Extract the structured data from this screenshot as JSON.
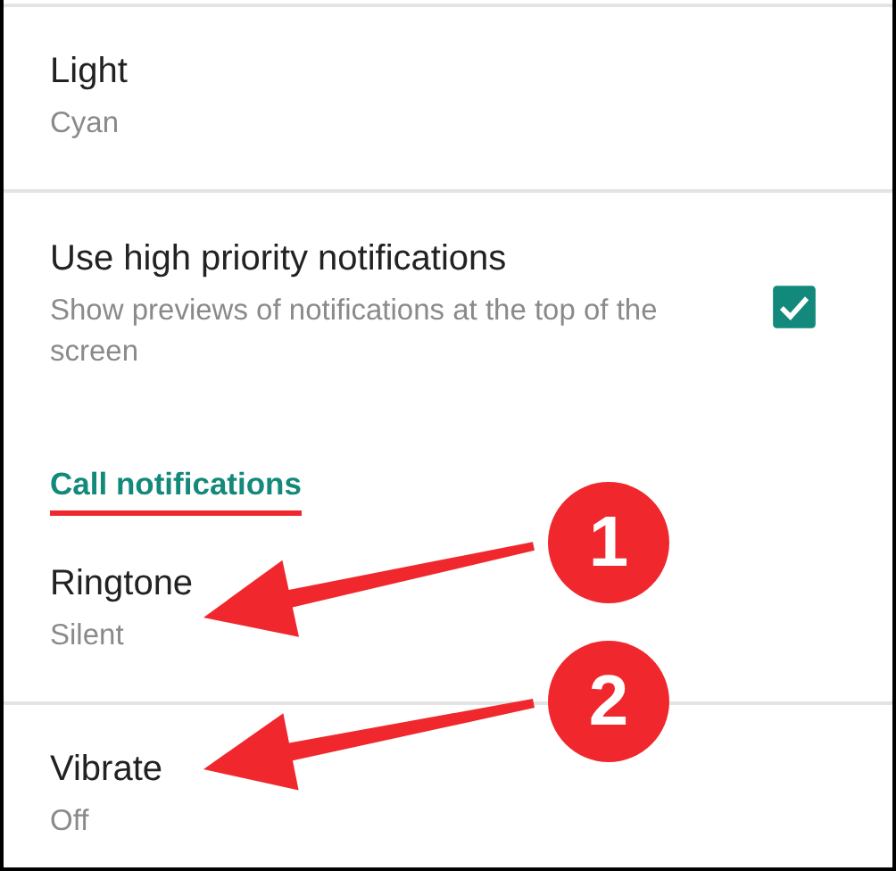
{
  "settings": [
    {
      "kind": "setting",
      "title": "Light",
      "summary": "Cyan",
      "divider_after": true
    },
    {
      "kind": "checkbox",
      "title": "Use high priority notifications",
      "summary": "Show previews of notifications at the top of the screen",
      "checked": true
    },
    {
      "kind": "header",
      "title": "Call notifications",
      "underlined": true
    },
    {
      "kind": "setting",
      "title": "Ringtone",
      "summary": "Silent",
      "divider_after": true
    },
    {
      "kind": "setting",
      "title": "Vibrate",
      "summary": "Off",
      "divider_after": false
    }
  ],
  "callouts": [
    {
      "label": "1"
    },
    {
      "label": "2"
    }
  ]
}
